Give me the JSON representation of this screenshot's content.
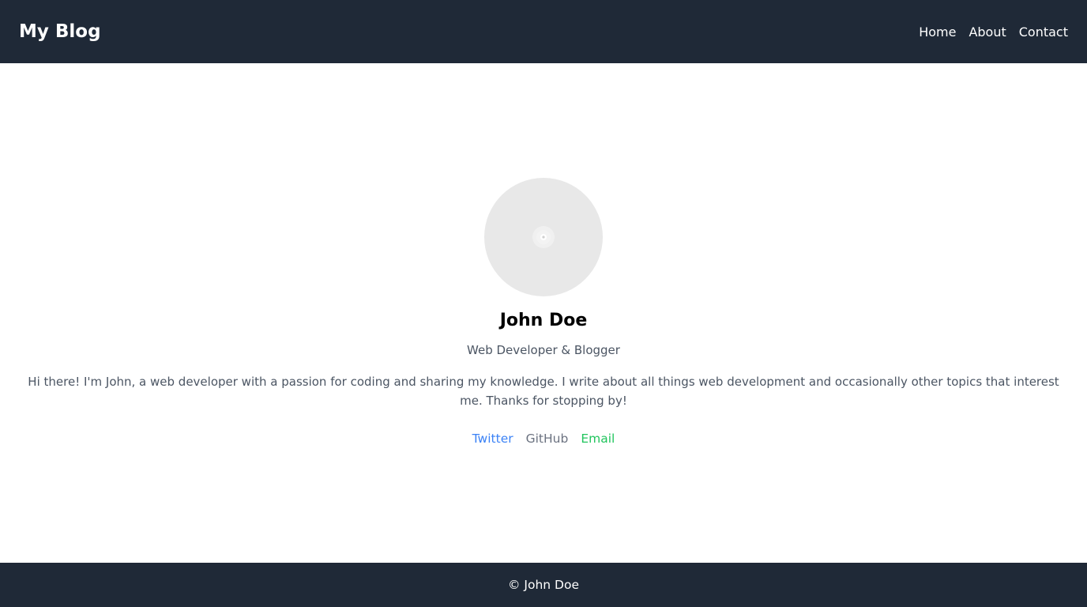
{
  "header": {
    "brand": "My Blog",
    "nav": [
      {
        "label": "Home"
      },
      {
        "label": "About"
      },
      {
        "label": "Contact"
      }
    ]
  },
  "profile": {
    "avatar_icon": "image-placeholder-icon",
    "name": "John Doe",
    "role": "Web Developer & Blogger",
    "bio": "Hi there! I'm John, a web developer with a passion for coding and sharing my knowledge. I write about all things web development and occasionally other topics that interest me. Thanks for stopping by!"
  },
  "socials": [
    {
      "label": "Twitter",
      "color": "#3b82f6"
    },
    {
      "label": "GitHub",
      "color": "#6b7280"
    },
    {
      "label": "Email",
      "color": "#22c55e"
    }
  ],
  "footer": {
    "text": "© John Doe"
  },
  "colors": {
    "header_bg": "#1f2937",
    "footer_bg": "#1f2937",
    "text_muted": "#4b5563",
    "avatar_bg": "#e8e8e8"
  }
}
